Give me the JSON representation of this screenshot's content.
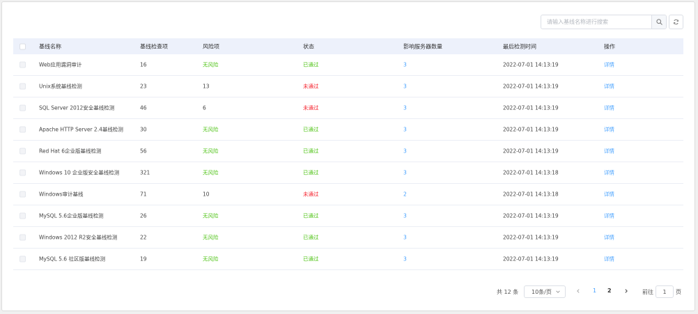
{
  "toolbar": {
    "search_placeholder": "请输入基线名称进行搜索"
  },
  "table": {
    "columns": [
      "基线名称",
      "基线检查项",
      "风险项",
      "状态",
      "影响服务器数量",
      "最后检测时间",
      "操作"
    ],
    "rows": [
      {
        "name": "Web应用漏洞审计",
        "items": "16",
        "risk": "无风险",
        "risk_type": "none",
        "status": "已通过",
        "status_type": "pass",
        "servers": "3",
        "time": "2022-07-01 14:13:19",
        "op": "详情"
      },
      {
        "name": "Unix系统基线检测",
        "items": "23",
        "risk": "13",
        "risk_type": "count",
        "status": "未通过",
        "status_type": "fail",
        "servers": "3",
        "time": "2022-07-01 14:13:19",
        "op": "详情"
      },
      {
        "name": "SQL Server 2012安全基线检测",
        "items": "46",
        "risk": "6",
        "risk_type": "count",
        "status": "未通过",
        "status_type": "fail",
        "servers": "3",
        "time": "2022-07-01 14:13:19",
        "op": "详情"
      },
      {
        "name": "Apache HTTP Server 2.4基线检测",
        "items": "30",
        "risk": "无风险",
        "risk_type": "none",
        "status": "已通过",
        "status_type": "pass",
        "servers": "3",
        "time": "2022-07-01 14:13:19",
        "op": "详情"
      },
      {
        "name": "Red Hat 6企业版基线检测",
        "items": "56",
        "risk": "无风险",
        "risk_type": "none",
        "status": "已通过",
        "status_type": "pass",
        "servers": "3",
        "time": "2022-07-01 14:13:19",
        "op": "详情"
      },
      {
        "name": "Windows 10 企业版安全基线检测",
        "items": "321",
        "risk": "无风险",
        "risk_type": "none",
        "status": "已通过",
        "status_type": "pass",
        "servers": "3",
        "time": "2022-07-01 14:13:18",
        "op": "详情"
      },
      {
        "name": "Windows审计基线",
        "items": "71",
        "risk": "10",
        "risk_type": "count",
        "status": "未通过",
        "status_type": "fail",
        "servers": "2",
        "time": "2022-07-01 14:13:18",
        "op": "详情"
      },
      {
        "name": "MySQL 5.6企业版基线检测",
        "items": "26",
        "risk": "无风险",
        "risk_type": "none",
        "status": "已通过",
        "status_type": "pass",
        "servers": "3",
        "time": "2022-07-01 14:13:19",
        "op": "详情"
      },
      {
        "name": "Windows 2012 R2安全基线检测",
        "items": "22",
        "risk": "无风险",
        "risk_type": "none",
        "status": "已通过",
        "status_type": "pass",
        "servers": "3",
        "time": "2022-07-01 14:13:19",
        "op": "详情"
      },
      {
        "name": "MySQL 5.6 社区版基线检测",
        "items": "19",
        "risk": "无风险",
        "risk_type": "none",
        "status": "已通过",
        "status_type": "pass",
        "servers": "3",
        "time": "2022-07-01 14:13:19",
        "op": "详情"
      }
    ]
  },
  "pagination": {
    "total_label": "共 12 条",
    "page_size": "10条/页",
    "pages": [
      "1",
      "2"
    ],
    "current_page": "1",
    "goto_label": "前往",
    "goto_value": "1",
    "goto_unit": "页"
  },
  "colors": {
    "pass": "#52c41a",
    "fail": "#f5222d",
    "link": "#409eff",
    "header_bg": "#edf1fb"
  },
  "icons": {
    "search": "search-icon",
    "refresh": "refresh-icon",
    "prev": "chevron-left-icon",
    "next": "chevron-right-icon",
    "dropdown": "chevron-down-icon"
  }
}
